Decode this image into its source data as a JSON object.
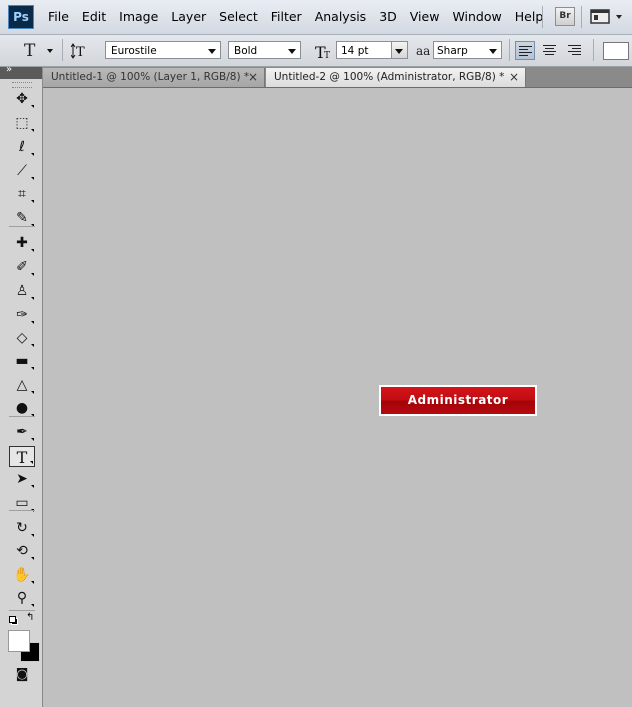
{
  "menubar": {
    "logo": "Ps",
    "items": [
      "File",
      "Edit",
      "Image",
      "Layer",
      "Select",
      "Filter",
      "Analysis",
      "3D",
      "View",
      "Window",
      "Help"
    ],
    "bridge_label": "Br"
  },
  "options": {
    "tool_glyph": "T",
    "font_family": "Eurostile",
    "font_style": "Bold",
    "font_size": "14 pt",
    "aa_label": "aa",
    "anti_alias": "Sharp"
  },
  "tabs": [
    {
      "label": "Untitled-1 @ 100% (Layer 1, RGB/8) *",
      "active": false
    },
    {
      "label": "Untitled-2 @ 100% (Administrator, RGB/8) *",
      "active": true
    }
  ],
  "tab_close_glyph": "×",
  "toolbox": {
    "collapse_glyph": "»",
    "tools": [
      {
        "name": "move-tool-icon",
        "glyph": "✥"
      },
      {
        "name": "marquee-tool-icon",
        "glyph": "⬚"
      },
      {
        "name": "lasso-tool-icon",
        "glyph": "ℓ"
      },
      {
        "name": "quick-select-tool-icon",
        "glyph": "⟋"
      },
      {
        "name": "crop-tool-icon",
        "glyph": "⌗"
      },
      {
        "name": "eyedropper-tool-icon",
        "glyph": "✎"
      },
      {
        "name": "healing-brush-tool-icon",
        "glyph": "✚"
      },
      {
        "name": "brush-tool-icon",
        "glyph": "✐"
      },
      {
        "name": "clone-stamp-tool-icon",
        "glyph": "♙"
      },
      {
        "name": "history-brush-tool-icon",
        "glyph": "✑"
      },
      {
        "name": "eraser-tool-icon",
        "glyph": "◇"
      },
      {
        "name": "gradient-tool-icon",
        "glyph": "▬"
      },
      {
        "name": "blur-tool-icon",
        "glyph": "△"
      },
      {
        "name": "dodge-tool-icon",
        "glyph": "●"
      },
      {
        "name": "pen-tool-icon",
        "glyph": "✒"
      },
      {
        "name": "type-tool-icon",
        "glyph": "T"
      },
      {
        "name": "path-select-tool-icon",
        "glyph": "➤"
      },
      {
        "name": "shape-tool-icon",
        "glyph": "▭"
      },
      {
        "name": "3d-rotate-tool-icon",
        "glyph": "↻"
      },
      {
        "name": "3d-orbit-tool-icon",
        "glyph": "⟲"
      },
      {
        "name": "hand-tool-icon",
        "glyph": "✋"
      },
      {
        "name": "zoom-tool-icon",
        "glyph": "⚲"
      }
    ],
    "swap_glyph": "↰",
    "quick_mask_glyph": "◙"
  },
  "canvas": {
    "button_text": "Administrator",
    "button_color": "#c00d12"
  }
}
